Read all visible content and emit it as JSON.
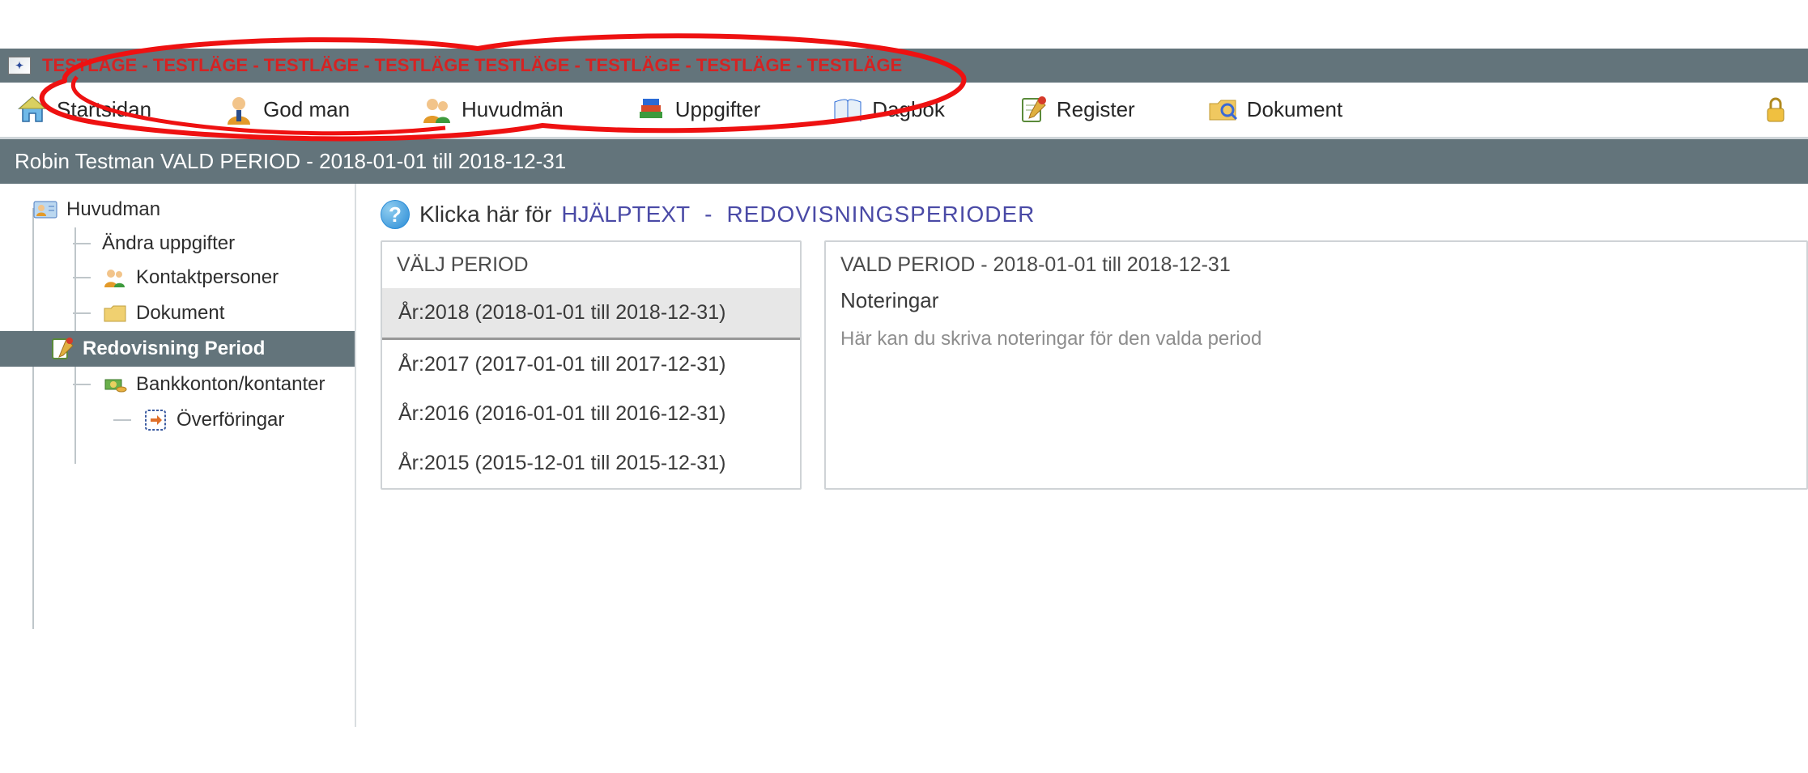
{
  "test_mode_banner": "TESTLÄGE - TESTLÄGE - TESTLÄGE - TESTLÄGE TESTLÄGE - TESTLÄGE - TESTLÄGE - TESTLÄGE",
  "toolbar": {
    "items": [
      {
        "label": "Startsidan",
        "icon": "home-icon"
      },
      {
        "label": "God man",
        "icon": "person-suit-icon"
      },
      {
        "label": "Huvudmän",
        "icon": "people-icon"
      },
      {
        "label": "Uppgifter",
        "icon": "books-icon"
      },
      {
        "label": "Dagbok",
        "icon": "open-book-icon"
      },
      {
        "label": "Register",
        "icon": "notepad-pencil-icon"
      },
      {
        "label": "Dokument",
        "icon": "folder-search-icon"
      }
    ],
    "lock_icon": "lock-icon"
  },
  "context_bar": "Robin Testman  VALD PERIOD - 2018-01-01 till 2018-12-31",
  "tree": {
    "root": {
      "label": "Huvudman",
      "icon": "contact-card-icon"
    },
    "children": [
      {
        "label": "Ändra uppgifter",
        "icon": null,
        "level": 1
      },
      {
        "label": "Kontaktpersoner",
        "icon": "people-icon",
        "level": 1
      },
      {
        "label": "Dokument",
        "icon": "folder-icon",
        "level": 1
      }
    ],
    "selected": {
      "label": "Redovisning Period",
      "icon": "notepad-pencil-icon"
    },
    "selected_children": [
      {
        "label": "Bankkonton/kontanter",
        "icon": "cash-icon",
        "level": 1
      },
      {
        "label": "Överföringar",
        "icon": "transfer-icon",
        "level": 2
      }
    ]
  },
  "help": {
    "prefix": "Klicka här för",
    "link": "HJÄLPTEXT",
    "sep": "-",
    "topic": "REDOVISNINGSPERIODER"
  },
  "period_panel": {
    "title": "VÄLJ PERIOD",
    "items": [
      {
        "label": "År:2018 (2018-01-01 till 2018-12-31)",
        "selected": true
      },
      {
        "label": "År:2017 (2017-01-01 till 2017-12-31)",
        "selected": false
      },
      {
        "label": "År:2016 (2016-01-01 till 2016-12-31)",
        "selected": false
      },
      {
        "label": "År:2015 (2015-12-01 till 2015-12-31)",
        "selected": false
      }
    ]
  },
  "notes_panel": {
    "title": "VALD PERIOD - 2018-01-01 till 2018-12-31",
    "subtitle": "Noteringar",
    "placeholder": "Här kan du skriva noteringar för den valda period"
  }
}
